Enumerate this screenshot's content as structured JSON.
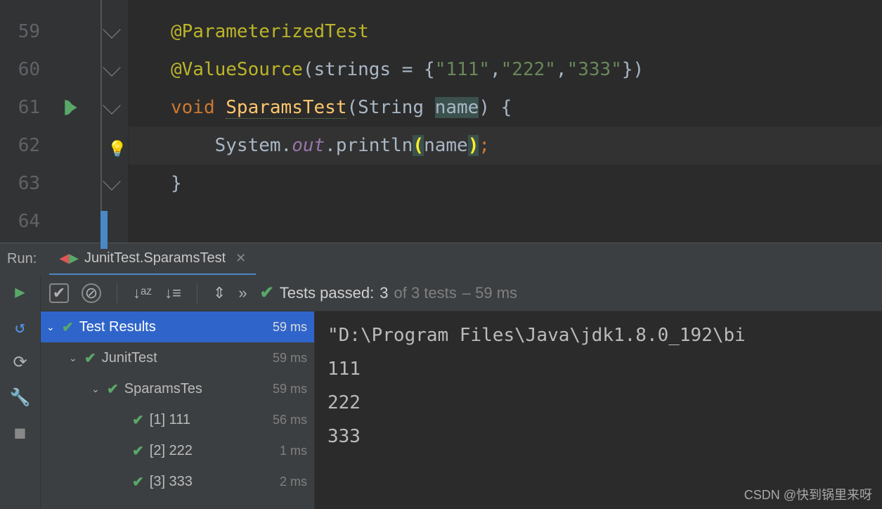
{
  "editor": {
    "line_numbers": [
      "59",
      "60",
      "61",
      "62",
      "63",
      "64"
    ],
    "current_line": 62,
    "code": {
      "annotation1": "@ParameterizedTest",
      "annotation2": "@ValueSource",
      "annotation2_arg_key": "strings",
      "annotation2_vals": [
        "\"111\"",
        "\"222\"",
        "\"333\""
      ],
      "keyword_void": "void",
      "method_name": "SparamsTest",
      "param_type": "String",
      "param_name": "name",
      "system": "System",
      "out": "out",
      "println": "println",
      "arg": "name",
      "close_brace": "}"
    }
  },
  "run": {
    "label": "Run:",
    "tab_title": "JunitTest.SparamsTest",
    "tests_passed_label": "Tests passed:",
    "tests_passed_count": "3",
    "tests_total_text": "of 3 tests",
    "tests_time_text": "– 59 ms",
    "tree": [
      {
        "label": "Test Results",
        "time": "59 ms",
        "level": 0,
        "selected": true,
        "chevron": true
      },
      {
        "label": "JunitTest",
        "time": "59 ms",
        "level": 1,
        "selected": false,
        "chevron": true
      },
      {
        "label": "SparamsTes",
        "time": "59 ms",
        "level": 2,
        "selected": false,
        "chevron": true
      },
      {
        "label": "[1] 111",
        "time": "56 ms",
        "level": 3,
        "selected": false,
        "chevron": false
      },
      {
        "label": "[2] 222",
        "time": "1 ms",
        "level": 3,
        "selected": false,
        "chevron": false
      },
      {
        "label": "[3] 333",
        "time": "2 ms",
        "level": 3,
        "selected": false,
        "chevron": false
      }
    ],
    "console": {
      "cmd": "\"D:\\Program Files\\Java\\jdk1.8.0_192\\bi",
      "lines": [
        "111",
        "222",
        "333"
      ]
    }
  },
  "watermark": "CSDN @快到锅里来呀"
}
